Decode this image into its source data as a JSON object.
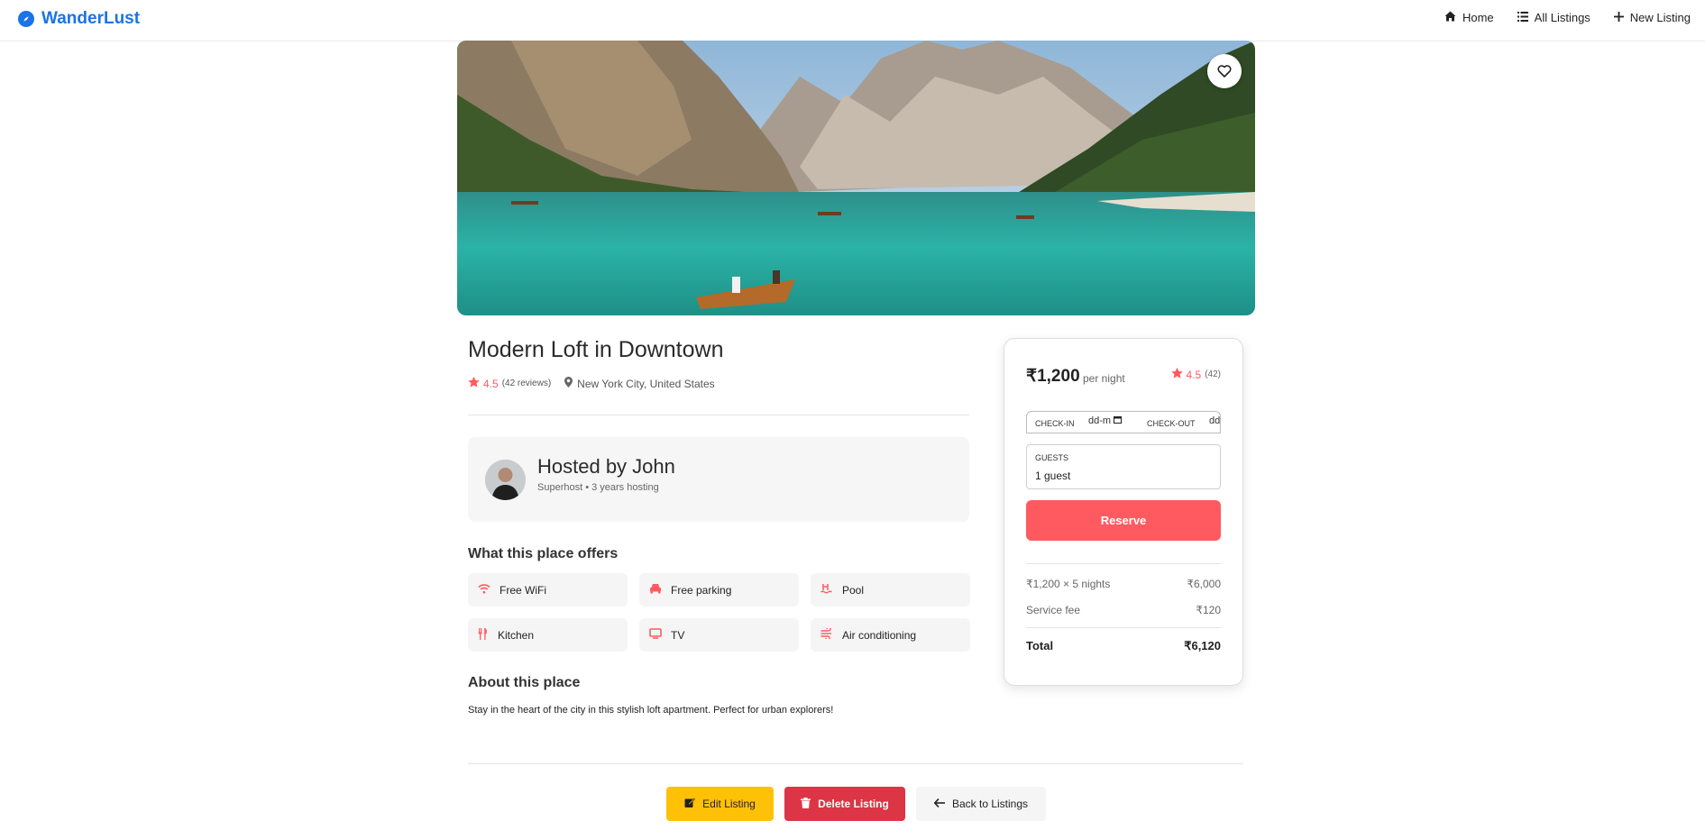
{
  "app": {
    "brand": "WanderLust"
  },
  "nav": {
    "home": "Home",
    "all_listings": "All Listings",
    "new_listing": "New Listing"
  },
  "listing": {
    "title": "Modern Loft in Downtown",
    "rating": "4.5",
    "reviews": "(42 reviews)",
    "location": "New York City, United States"
  },
  "host": {
    "name": "Hosted by John",
    "subtitle": "Superhost • 3 years hosting"
  },
  "offers": {
    "heading": "What this place offers",
    "items": [
      {
        "label": "Free WiFi",
        "icon": "wifi-icon"
      },
      {
        "label": "Free parking",
        "icon": "car-icon"
      },
      {
        "label": "Pool",
        "icon": "pool-icon"
      },
      {
        "label": "Kitchen",
        "icon": "utensils-icon"
      },
      {
        "label": "TV",
        "icon": "tv-icon"
      },
      {
        "label": "Air conditioning",
        "icon": "wind-icon"
      }
    ]
  },
  "about": {
    "heading": "About this place",
    "text": "Stay in the heart of the city in this stylish loft apartment. Perfect for urban explorers!"
  },
  "booking": {
    "price": "₹1,200",
    "per_night": "per night",
    "rating": "4.5",
    "rating_count": "(42)",
    "checkin_label": "CHECK-IN",
    "checkin_value": "dd-m",
    "checkout_label": "CHECK-OUT",
    "checkout_value": "dd",
    "guests_label": "GUESTS",
    "guests_value": "1 guest",
    "reserve": "Reserve",
    "nights_label": "₹1,200 × 5 nights",
    "nights_value": "₹6,000",
    "fee_label": "Service fee",
    "fee_value": "₹120",
    "total_label": "Total",
    "total_value": "₹6,120"
  },
  "actions": {
    "edit": "Edit Listing",
    "delete": "Delete Listing",
    "back": "Back to Listings"
  },
  "colors": {
    "brand": "#1a73e8",
    "accent": "#ff5a5f",
    "edit": "#ffc107",
    "delete": "#dc3545"
  }
}
